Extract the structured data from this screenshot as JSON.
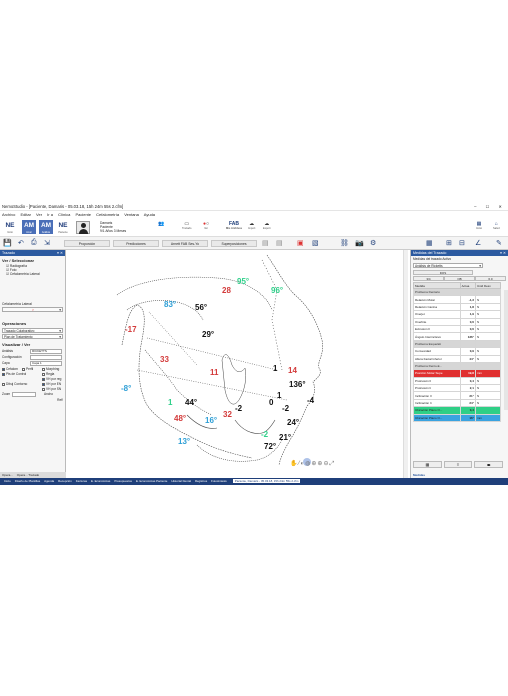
{
  "window": {
    "title": "NemoStudio - [Paciente, Damaris - 05.03.18, 15h 24m 55s 2.cfm]",
    "controls": "– ☐ ✕"
  },
  "menu": [
    "Archivo",
    "Editar",
    "Ver",
    "Ir a",
    "Clínica",
    "Paciente",
    "Cefalometría",
    "Ventana",
    "Ayuda"
  ],
  "ribbon": {
    "buttons": [
      {
        "label": "NE",
        "caption": "Inicio"
      },
      {
        "label": "AM",
        "caption": "Amar"
      },
      {
        "label": "AM",
        "caption": "Análisis"
      },
      {
        "label": "NE",
        "caption": "Paciente"
      }
    ],
    "patient": {
      "name": "Damaris",
      "surname": "Paciente",
      "age": "9/1 Años 3 Meses"
    },
    "tracing_label": "Trazado",
    "view_label": "Ver",
    "fab_label": "FAB",
    "fab_caption": "Mis Archivos",
    "import_label": "Import",
    "export_label": "Export",
    "apps_label": "Inicio",
    "home_label": "Salud"
  },
  "toolbar": {
    "tabs": [
      "Proporción",
      "Predicciones",
      "Arnett FAB Ses-Yo",
      "Superposiciones"
    ]
  },
  "left_panel": {
    "title": "Trazado",
    "section_title": "Ver / Seleccionar",
    "tree": [
      "Radiografía",
      "Foto",
      "Cefalometría Lateral"
    ],
    "calibration_label": "Cefalometría Lateral",
    "operations_title": "Operaciones",
    "operations_combo": "Trazado Colaborativo",
    "plan_combo": "Plan de Tratamiento",
    "view_title": "Visualizar / Ver",
    "analysis_label": "Análisis",
    "analysis_value": "RICKETTS",
    "config_label": "Configuración",
    "layer_label": "Capa",
    "layer_value": "Capa 1",
    "checks": [
      {
        "label": "Cefalom",
        "on": true
      },
      {
        "label": "Perfil",
        "on": false
      },
      {
        "label": "Morphing",
        "on": false
      },
      {
        "label": "Pts de Control",
        "on": true
      },
      {
        "label": "Regla",
        "on": false
      },
      {
        "label": "VH por reg",
        "on": true
      },
      {
        "label": "Dibuj Contorno",
        "on": false
      },
      {
        "label": "VH por EN",
        "on": true
      },
      {
        "label": "VH por SN",
        "on": false
      }
    ],
    "zoom_label": "Zoom",
    "avg_label": "Ancho",
    "refresh_label": "Ref!",
    "tabs": [
      "Opera...",
      "Opera... Trazado"
    ]
  },
  "canvas": {
    "labels": [
      {
        "text": "28",
        "color": "#d33a3a"
      },
      {
        "text": "95°",
        "color": "#2fd08a"
      },
      {
        "text": "96°",
        "color": "#2fd08a"
      },
      {
        "text": "83°",
        "color": "#2e9fd6"
      },
      {
        "text": "56°",
        "color": "#111111"
      },
      {
        "text": "-17",
        "color": "#d33a3a"
      },
      {
        "text": "29°",
        "color": "#111111"
      },
      {
        "text": "33",
        "color": "#d33a3a"
      },
      {
        "text": "11",
        "color": "#d33a3a"
      },
      {
        "text": "14",
        "color": "#d33a3a"
      },
      {
        "text": "1",
        "color": "#111111"
      },
      {
        "text": "136°",
        "color": "#111111"
      },
      {
        "text": "-8°",
        "color": "#2e9fd6"
      },
      {
        "text": "1",
        "color": "#2fd08a"
      },
      {
        "text": "44°",
        "color": "#111111"
      },
      {
        "text": "48°",
        "color": "#d33a3a"
      },
      {
        "text": "32",
        "color": "#d33a3a"
      },
      {
        "text": "-2",
        "color": "#111111"
      },
      {
        "text": "16°",
        "color": "#2e9fd6"
      },
      {
        "text": "0",
        "color": "#111111"
      },
      {
        "text": "1",
        "color": "#111111"
      },
      {
        "text": "-2",
        "color": "#111111"
      },
      {
        "text": "-4",
        "color": "#111111"
      },
      {
        "text": "-2",
        "color": "#2fd08a"
      },
      {
        "text": "24°",
        "color": "#111111"
      },
      {
        "text": "13°",
        "color": "#2e9fd6"
      },
      {
        "text": "21°",
        "color": "#111111"
      },
      {
        "text": "72°",
        "color": "#111111"
      }
    ]
  },
  "right_panel": {
    "title": "Medidas del Trazado",
    "subtitle": "Medidas del trazado Activo",
    "combo": "Análisis de Ricketts",
    "tabs": [
      "DOS",
      "3/4",
      "OB",
      "6.0"
    ],
    "columns": [
      "Medida",
      "Actua",
      "Unid Desv"
    ],
    "rows": [
      {
        "name": "Problema Dentario",
        "value": "",
        "unit": "",
        "style": "group"
      },
      {
        "name": "Relación Molar",
        "value": "-1,3",
        "unit": "N",
        "style": ""
      },
      {
        "name": "Relación Canina",
        "value": "1,8",
        "unit": "N",
        "style": ""
      },
      {
        "name": "Overjet",
        "value": "1,9",
        "unit": "N",
        "style": ""
      },
      {
        "name": "Overbite",
        "value": "0,6",
        "unit": "N",
        "style": ""
      },
      {
        "name": "Extrusión Il",
        "value": "0,6",
        "unit": "N",
        "style": ""
      },
      {
        "name": "Ángulo Interincisivo",
        "value": "136°",
        "unit": "N",
        "style": ""
      },
      {
        "name": "Problema Esqueléti",
        "value": "",
        "unit": "",
        "style": "group"
      },
      {
        "name": "Convexidad",
        "value": "0,9",
        "unit": "N",
        "style": ""
      },
      {
        "name": "Altura Facial Inferior",
        "value": "44°",
        "unit": "N",
        "style": ""
      },
      {
        "name": "Problema Dento-E...",
        "value": "",
        "unit": "",
        "style": "group"
      },
      {
        "name": "Posición Molar Supe",
        "value": "19,8",
        "unit": "mm",
        "style": "red"
      },
      {
        "name": "Protrusión Il",
        "value": "0,4",
        "unit": "N",
        "style": ""
      },
      {
        "name": "Protrusión Ii",
        "value": "2,1",
        "unit": "N",
        "style": ""
      },
      {
        "name": "Inclinación Il",
        "value": "21°",
        "unit": "N",
        "style": ""
      },
      {
        "name": "Inclinación Ii",
        "value": "24°",
        "unit": "N",
        "style": ""
      },
      {
        "name": "Ubicación Plano O...",
        "value": "0,4",
        "unit": "",
        "style": "green"
      },
      {
        "name": "Ubicación Plano O...",
        "value": "16°",
        "unit": "mm",
        "style": "blue"
      }
    ],
    "footer": "Medidas"
  },
  "statusbar": {
    "items": [
      "Inicio",
      "Diseño de Plantillas",
      "Agenda",
      "Recepción",
      "Facturas",
      "E. Económicas",
      "Presupuestos",
      "E. Económicas Paciente",
      "Historial Dental",
      "Registros",
      "Fotosíntesis"
    ],
    "active": "Paciente, Damaris - 05.03.18, 15h 24m 55s 2.cfm"
  },
  "colors": {
    "brand": "#1f3f7a",
    "panel_header": "#2c5aa0",
    "red": "#d33a3a",
    "green": "#2fd08a",
    "blue": "#2e9fd6"
  }
}
